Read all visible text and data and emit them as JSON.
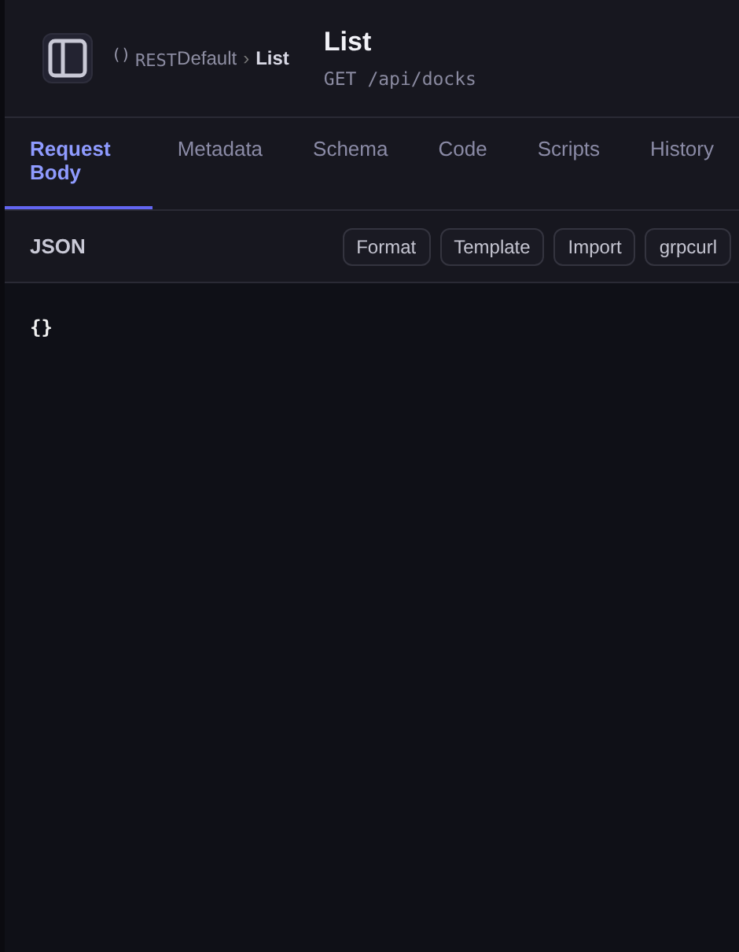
{
  "breadcrumb": {
    "badge": "()",
    "protocol": "REST",
    "group": "Default",
    "separator": "›",
    "current": "List"
  },
  "request": {
    "title": "List",
    "method": "GET",
    "path": "/api/docks"
  },
  "tabs": [
    {
      "label": "Request Body",
      "selected": true
    },
    {
      "label": "Metadata",
      "selected": false
    },
    {
      "label": "Schema",
      "selected": false
    },
    {
      "label": "Code",
      "selected": false
    },
    {
      "label": "Scripts",
      "selected": false
    },
    {
      "label": "History",
      "selected": false
    }
  ],
  "toolbar": {
    "label": "JSON",
    "buttons": [
      "Format",
      "Template",
      "Import",
      "grpcurl"
    ]
  },
  "editor": {
    "content": "{}"
  }
}
